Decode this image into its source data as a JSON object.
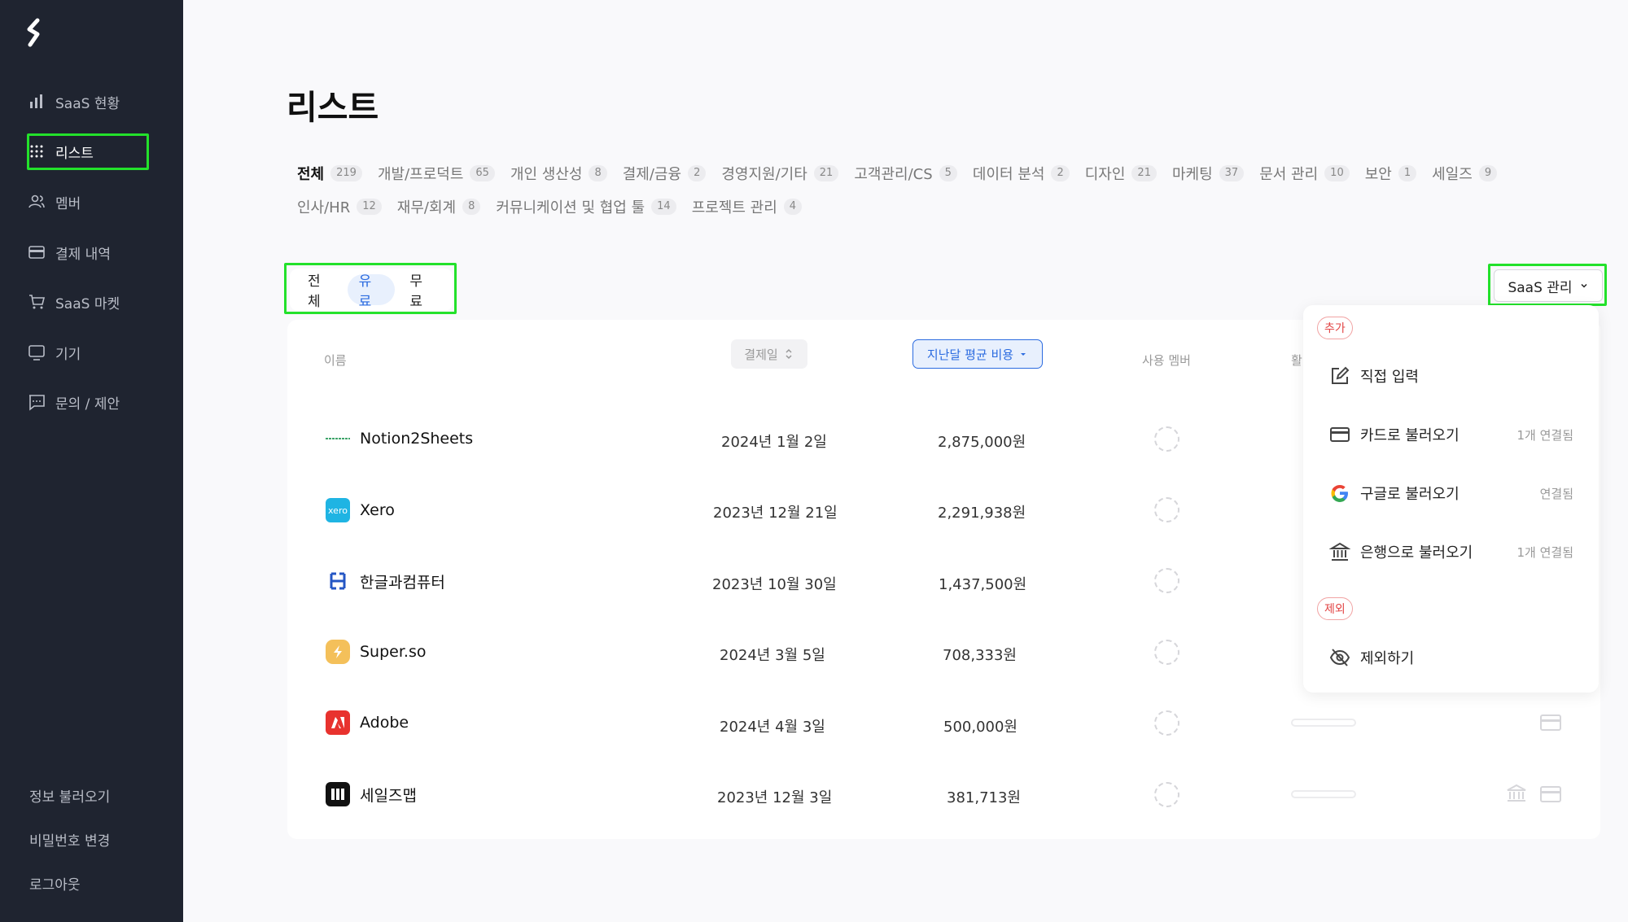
{
  "sidebar": {
    "items": [
      {
        "label": "SaaS 현황",
        "icon": "bar-chart-icon"
      },
      {
        "label": "리스트",
        "icon": "grid-dots-icon"
      },
      {
        "label": "멤버",
        "icon": "users-icon"
      },
      {
        "label": "결제 내역",
        "icon": "credit-card-icon"
      },
      {
        "label": "SaaS 마켓",
        "icon": "cart-icon"
      },
      {
        "label": "기기",
        "icon": "monitor-icon"
      },
      {
        "label": "문의 / 제안",
        "icon": "chat-icon"
      }
    ],
    "bottom": [
      "정보 불러오기",
      "비밀번호 변경",
      "로그아웃"
    ]
  },
  "page": {
    "title": "리스트"
  },
  "categories": [
    {
      "label": "전체",
      "count": "219"
    },
    {
      "label": "개발/프로덕트",
      "count": "65"
    },
    {
      "label": "개인 생산성",
      "count": "8"
    },
    {
      "label": "결제/금융",
      "count": "2"
    },
    {
      "label": "경영지원/기타",
      "count": "21"
    },
    {
      "label": "고객관리/CS",
      "count": "5"
    },
    {
      "label": "데이터 분석",
      "count": "2"
    },
    {
      "label": "디자인",
      "count": "21"
    },
    {
      "label": "마케팅",
      "count": "37"
    },
    {
      "label": "문서 관리",
      "count": "10"
    },
    {
      "label": "보안",
      "count": "1"
    },
    {
      "label": "세일즈",
      "count": "9"
    },
    {
      "label": "인사/HR",
      "count": "12"
    },
    {
      "label": "재무/회계",
      "count": "8"
    },
    {
      "label": "커뮤니케이션 및 협업 툴",
      "count": "14"
    },
    {
      "label": "프로젝트 관리",
      "count": "4"
    }
  ],
  "filter": {
    "all": "전체",
    "paid": "유료",
    "free": "무료"
  },
  "saas_button": "SaaS 관리",
  "table": {
    "headers": {
      "name": "이름",
      "date": "결제일",
      "cost": "지난달 평균 비용",
      "members": "사용 멤버",
      "partial": "활"
    },
    "rows": [
      {
        "name": "Notion2Sheets",
        "date": "2024년 1월 2일",
        "cost": "2,875,000원"
      },
      {
        "name": "Xero",
        "date": "2023년 12월 21일",
        "cost": "2,291,938원"
      },
      {
        "name": "한글과컴퓨터",
        "date": "2023년 10월 30일",
        "cost": "1,437,500원"
      },
      {
        "name": "Super.so",
        "date": "2024년 3월 5일",
        "cost": "708,333원"
      },
      {
        "name": "Adobe",
        "date": "2024년 4월 3일",
        "cost": "500,000원"
      },
      {
        "name": "세일즈맵",
        "date": "2023년 12월 3일",
        "cost": "381,713원"
      }
    ]
  },
  "dropdown": {
    "add_label": "추가",
    "exclude_label": "제외",
    "items": [
      {
        "label": "직접 입력",
        "status": ""
      },
      {
        "label": "카드로 불러오기",
        "status": "1개 연결됨"
      },
      {
        "label": "구글로 불러오기",
        "status": "연결됨"
      },
      {
        "label": "은행으로 불러오기",
        "status": "1개 연결됨"
      },
      {
        "label": "제외하기",
        "status": ""
      }
    ]
  },
  "colors": {
    "sidebar_bg": "#1f2430",
    "accent": "#2b6be0",
    "highlight": "#23e12b",
    "danger": "#e24545"
  }
}
